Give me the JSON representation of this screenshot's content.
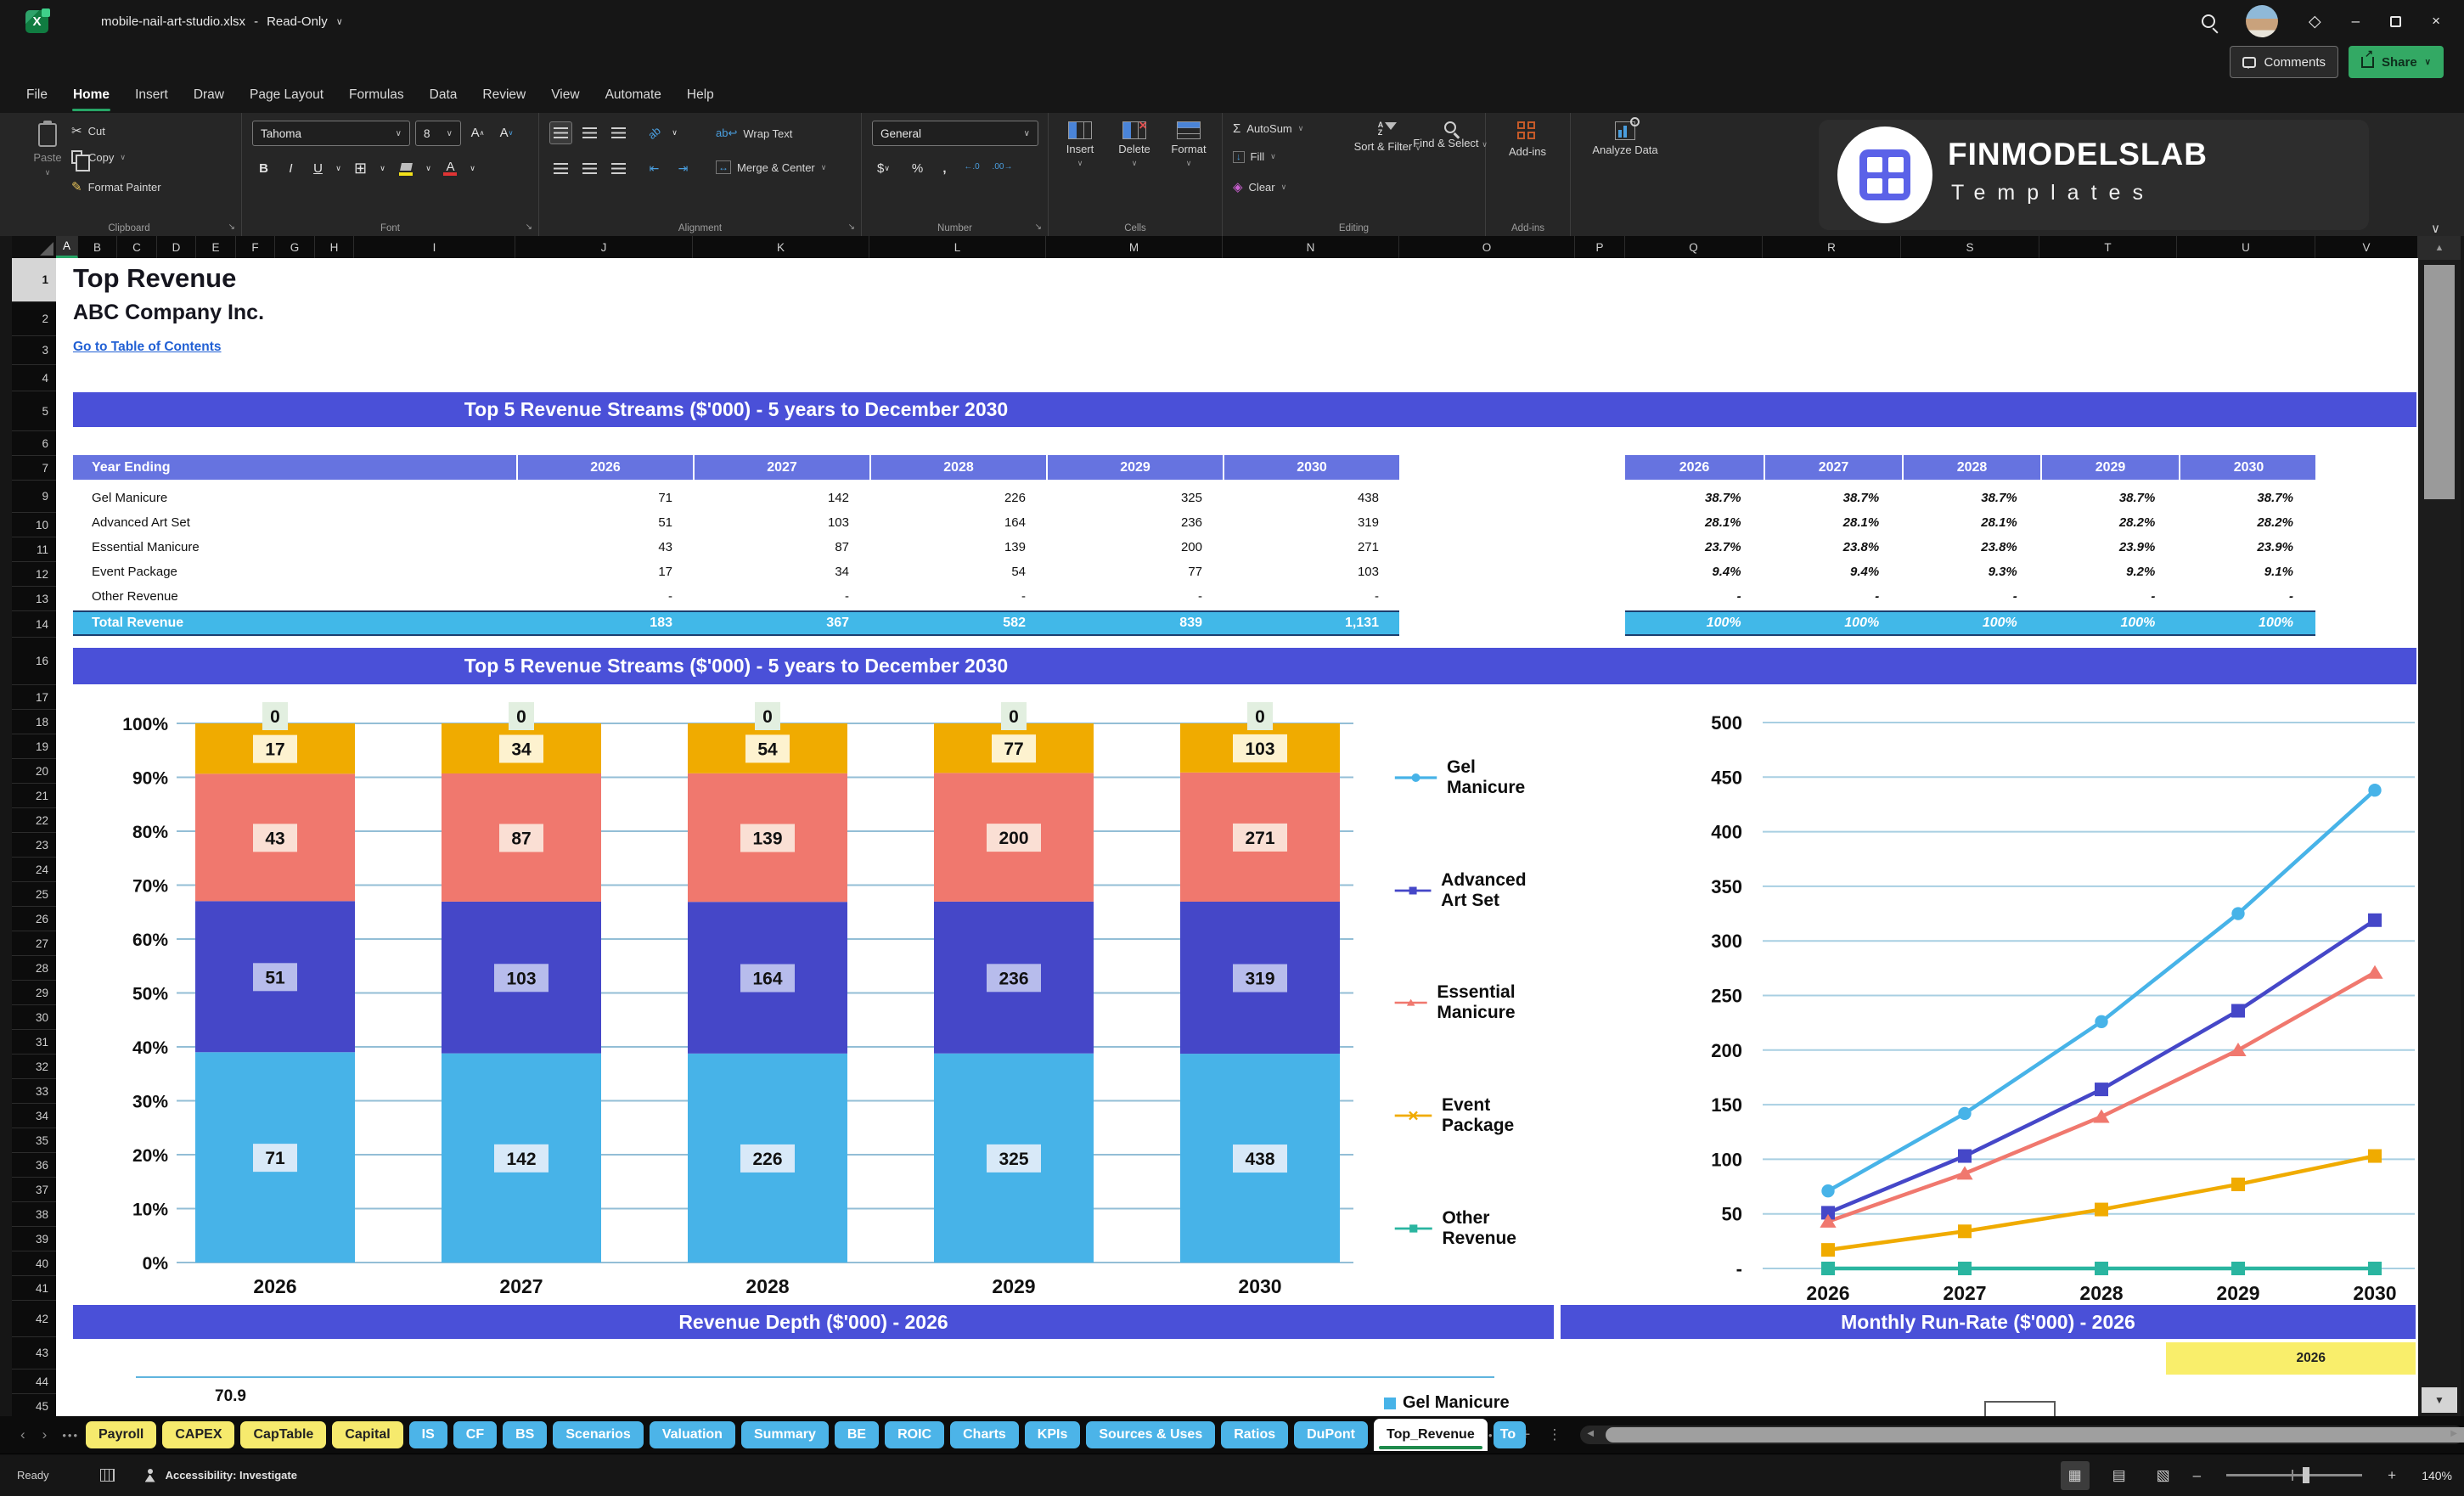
{
  "window": {
    "title": "mobile-nail-art-studio.xlsx",
    "separator": "-",
    "mode": "Read-Only",
    "comments": "Comments",
    "share": "Share"
  },
  "menu": {
    "active_index": 1,
    "items": [
      "File",
      "Home",
      "Insert",
      "Draw",
      "Page Layout",
      "Formulas",
      "Data",
      "Review",
      "View",
      "Automate",
      "Help"
    ]
  },
  "ribbon": {
    "clipboard": {
      "paste": "Paste",
      "cut": "Cut",
      "copy": "Copy",
      "format_painter": "Format Painter",
      "group": "Clipboard"
    },
    "font": {
      "family": "Tahoma",
      "size": "8",
      "group": "Font"
    },
    "alignment": {
      "wrap": "Wrap Text",
      "merge": "Merge & Center",
      "group": "Alignment"
    },
    "number": {
      "format": "General",
      "group": "Number"
    },
    "cells": {
      "insert": "Insert",
      "delete": "Delete",
      "format": "Format",
      "group": "Cells"
    },
    "editing": {
      "autosum": "AutoSum",
      "fill": "Fill",
      "clear": "Clear",
      "sort": "Sort & Filter",
      "find": "Find & Select",
      "group": "Editing"
    },
    "addins": {
      "label": "Add-ins",
      "analyze": "Analyze Data",
      "group": "Add-ins"
    },
    "brand": {
      "name": "FINMODELSLAB",
      "sub": "Templates"
    }
  },
  "grid": {
    "columns": [
      "A",
      "B",
      "C",
      "D",
      "E",
      "F",
      "G",
      "H",
      "I",
      "J",
      "K",
      "L",
      "M",
      "N",
      "O",
      "P",
      "Q",
      "R",
      "S",
      "T",
      "U",
      "V"
    ],
    "active_column": "A",
    "rows": [
      "1",
      "2",
      "3",
      "4",
      "5",
      "6",
      "7",
      "9",
      "10",
      "11",
      "12",
      "13",
      "14",
      "16",
      "17",
      "18",
      "19",
      "20",
      "21",
      "22",
      "23",
      "24",
      "25",
      "26",
      "27",
      "28",
      "29",
      "30",
      "31",
      "32",
      "33",
      "34",
      "35",
      "36",
      "37",
      "38",
      "39",
      "40",
      "41",
      "42",
      "43",
      "44",
      "45"
    ],
    "active_row": "1"
  },
  "sheet": {
    "page_title": "Top Revenue",
    "company": "ABC Company Inc.",
    "toc_link": "Go to Table of Contents",
    "section1_title": "Top 5 Revenue Streams ($'000) - 5 years to December 2030",
    "section2_title": "Top 5 Revenue Streams ($'000) - 5 years to December 2030",
    "section3_title": "Revenue Depth ($'000) - 2026",
    "section4_title": "Monthly Run-Rate ($'000) - 2026",
    "year_ending_label": "Year Ending",
    "years": [
      "2026",
      "2027",
      "2028",
      "2029",
      "2030"
    ],
    "revenue_rows": [
      {
        "label": "Gel Manicure",
        "values": [
          "71",
          "142",
          "226",
          "325",
          "438"
        ],
        "pct": [
          "38.7%",
          "38.7%",
          "38.7%",
          "38.7%",
          "38.7%"
        ]
      },
      {
        "label": "Advanced Art Set",
        "values": [
          "51",
          "103",
          "164",
          "236",
          "319"
        ],
        "pct": [
          "28.1%",
          "28.1%",
          "28.1%",
          "28.2%",
          "28.2%"
        ]
      },
      {
        "label": "Essential Manicure",
        "values": [
          "43",
          "87",
          "139",
          "200",
          "271"
        ],
        "pct": [
          "23.7%",
          "23.8%",
          "23.8%",
          "23.9%",
          "23.9%"
        ]
      },
      {
        "label": "Event Package",
        "values": [
          "17",
          "34",
          "54",
          "77",
          "103"
        ],
        "pct": [
          "9.4%",
          "9.4%",
          "9.3%",
          "9.2%",
          "9.1%"
        ]
      },
      {
        "label": "Other Revenue",
        "values": [
          "-",
          "-",
          "-",
          "-",
          "-"
        ],
        "pct": [
          "-",
          "-",
          "-",
          "-",
          "-"
        ]
      }
    ],
    "total_row": {
      "label": "Total Revenue",
      "values": [
        "183",
        "367",
        "582",
        "839",
        "1,131"
      ],
      "pct": [
        "100%",
        "100%",
        "100%",
        "100%",
        "100%"
      ]
    },
    "runrate_year_cell": "2026",
    "depth_partial_label": "70.9",
    "depth_partial_legend": "Gel Manicure"
  },
  "chart_data": [
    {
      "type": "bar",
      "stacked": true,
      "percent_of_total": true,
      "title": "Top 5 Revenue Streams ($'000) - 5 years to December 2030",
      "categories": [
        "2026",
        "2027",
        "2028",
        "2029",
        "2030"
      ],
      "series": [
        {
          "name": "Gel Manicure",
          "color": "#47b3e8",
          "label_bg": "#d8e9f8",
          "values": [
            71,
            142,
            226,
            325,
            438
          ]
        },
        {
          "name": "Advanced Art Set",
          "color": "#4547c8",
          "label_bg": "#b7bcec",
          "values": [
            51,
            103,
            164,
            236,
            319
          ]
        },
        {
          "name": "Essential Manicure",
          "color": "#f0786e",
          "label_bg": "#fadfd4",
          "values": [
            43,
            87,
            139,
            200,
            271
          ]
        },
        {
          "name": "Event Package",
          "color": "#f0ab00",
          "label_bg": "#fdf2cf",
          "values": [
            17,
            34,
            54,
            77,
            103
          ]
        },
        {
          "name": "Other Revenue",
          "color": "#2ab5a0",
          "label_bg": "#e2efe0",
          "values": [
            0,
            0,
            0,
            0,
            0
          ]
        }
      ],
      "y_ticks": [
        "100%",
        "90%",
        "80%",
        "70%",
        "60%",
        "50%",
        "40%",
        "30%",
        "20%",
        "10%",
        "0%"
      ],
      "grid": true,
      "legend_position": "right"
    },
    {
      "type": "line",
      "categories": [
        "2026",
        "2027",
        "2028",
        "2029",
        "2030"
      ],
      "series": [
        {
          "name": "Gel Manicure",
          "color": "#47b3e8",
          "marker": "circle",
          "values": [
            71,
            142,
            226,
            325,
            438
          ]
        },
        {
          "name": "Advanced Art Set",
          "color": "#4547c8",
          "marker": "square",
          "values": [
            51,
            103,
            164,
            236,
            319
          ]
        },
        {
          "name": "Essential Manicure",
          "color": "#f0786e",
          "marker": "triangle",
          "values": [
            43,
            87,
            139,
            200,
            271
          ]
        },
        {
          "name": "Event Package",
          "color": "#f0ab00",
          "marker": "x",
          "values": [
            17,
            34,
            54,
            77,
            103
          ]
        },
        {
          "name": "Other Revenue",
          "color": "#2ab5a0",
          "marker": "square",
          "values": [
            0,
            0,
            0,
            0,
            0
          ]
        }
      ],
      "ylim": [
        0,
        500
      ],
      "y_tick_step": 50,
      "y_tick_labels": [
        "500",
        "450",
        "400",
        "350",
        "300",
        "250",
        "200",
        "150",
        "100",
        "50",
        "-"
      ],
      "grid": true
    }
  ],
  "tabs": {
    "items": [
      {
        "label": "Payroll",
        "color": "yellow"
      },
      {
        "label": "CAPEX",
        "color": "yellow"
      },
      {
        "label": "CapTable",
        "color": "yellow"
      },
      {
        "label": "Capital",
        "color": "yellow"
      },
      {
        "label": "IS",
        "color": "blue"
      },
      {
        "label": "CF",
        "color": "blue"
      },
      {
        "label": "BS",
        "color": "blue"
      },
      {
        "label": "Scenarios",
        "color": "blue"
      },
      {
        "label": "Valuation",
        "color": "blue"
      },
      {
        "label": "Summary",
        "color": "blue"
      },
      {
        "label": "BE",
        "color": "blue"
      },
      {
        "label": "ROIC",
        "color": "blue"
      },
      {
        "label": "Charts",
        "color": "blue"
      },
      {
        "label": "KPIs",
        "color": "blue"
      },
      {
        "label": "Sources & Uses",
        "color": "blue"
      },
      {
        "label": "Ratios",
        "color": "bl​ue"
      },
      {
        "label": "DuPont",
        "color": "blue"
      },
      {
        "label": "Top_Revenue",
        "color": "active"
      },
      {
        "label": "To",
        "color": "blue"
      }
    ]
  },
  "status": {
    "ready": "Ready",
    "accessibility": "Accessibility: Investigate",
    "zoom": "140%"
  }
}
